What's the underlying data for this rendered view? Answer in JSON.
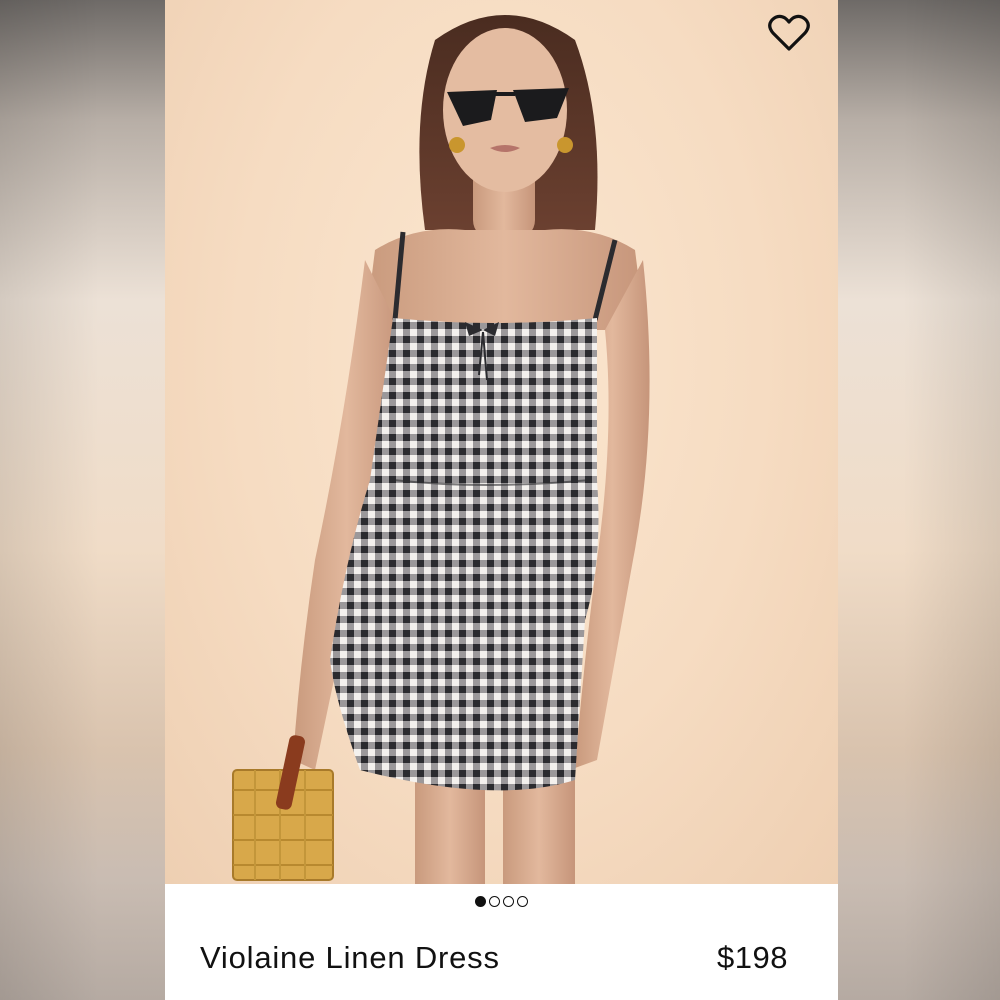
{
  "product": {
    "name": "Violaine Linen Dress",
    "price": "$198"
  },
  "favorite": {
    "icon": "heart-outline-icon",
    "selected": false
  },
  "carousel": {
    "total": 4,
    "active_index": 0
  },
  "colors": {
    "text": "#111111",
    "photo_background": "#f6dcc2",
    "gingham_dark": "#2b2b2f",
    "gingham_light": "#f4f1ee"
  }
}
